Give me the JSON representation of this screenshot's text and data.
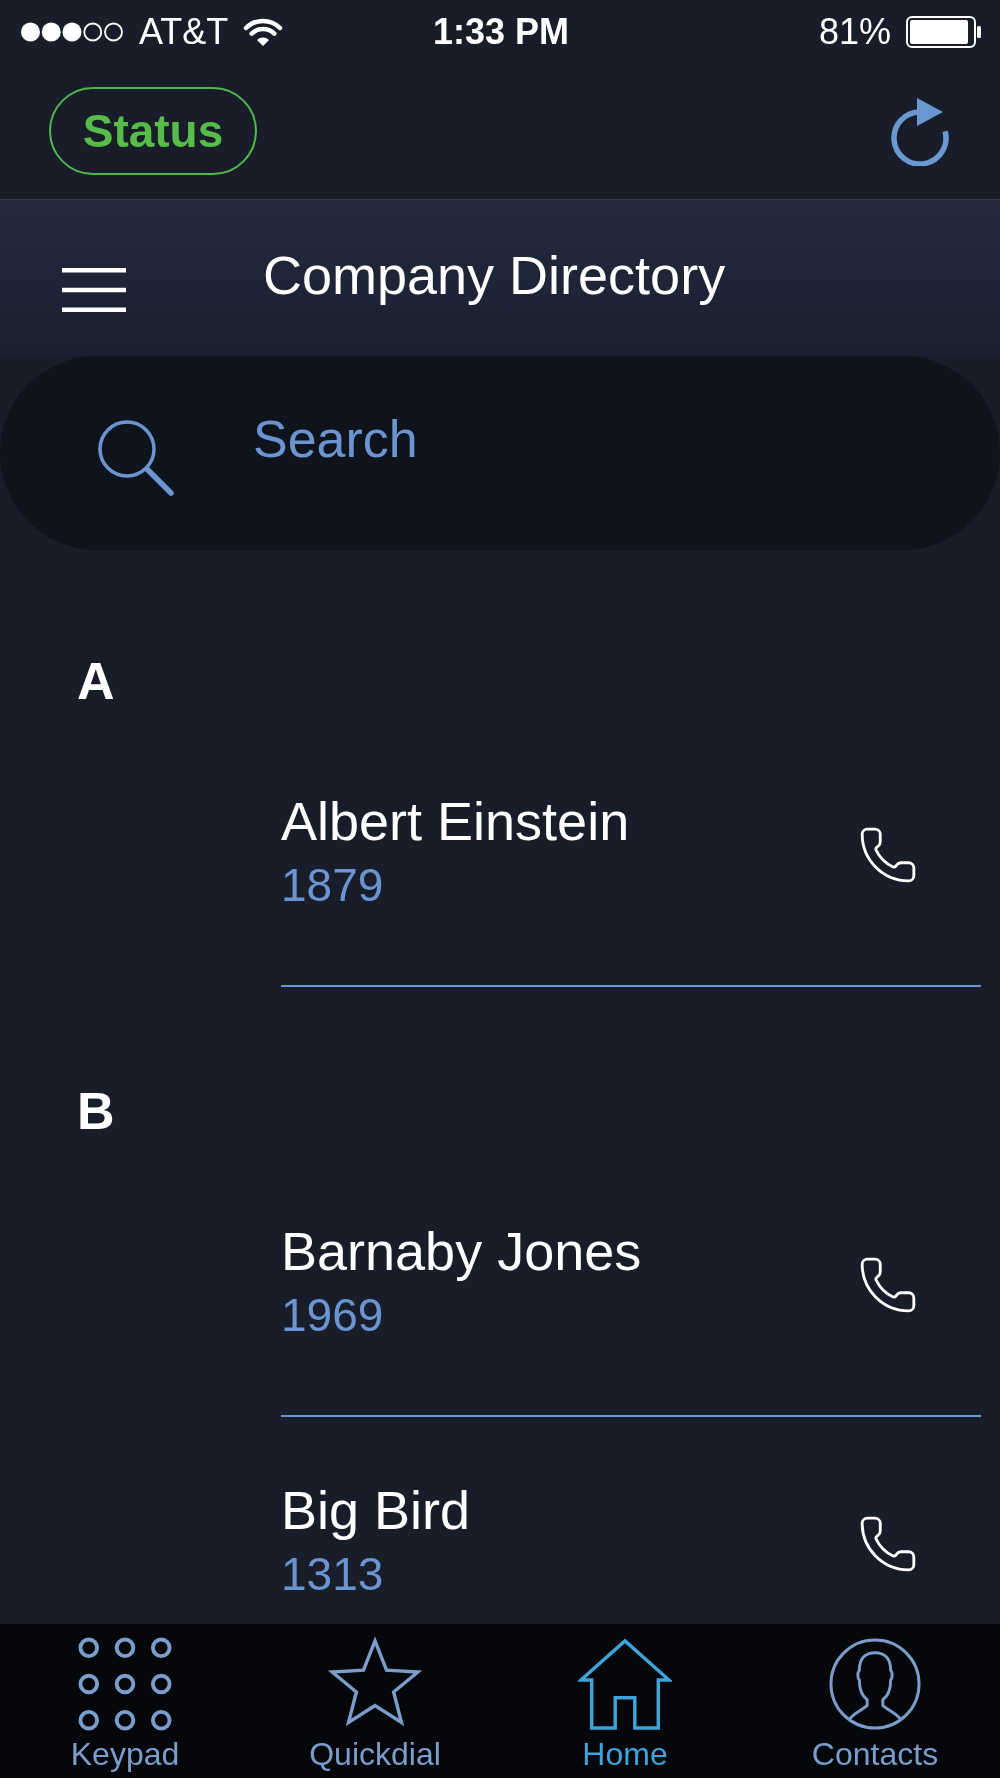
{
  "status_bar": {
    "carrier": "AT&T",
    "time": "1:33 PM",
    "battery": "81%"
  },
  "header": {
    "status_button": "Status"
  },
  "title_bar": {
    "title": "Company Directory"
  },
  "search": {
    "placeholder": "Search"
  },
  "sections": [
    {
      "letter": "A",
      "contacts": [
        {
          "name": "Albert Einstein",
          "extension": "1879"
        }
      ]
    },
    {
      "letter": "B",
      "contacts": [
        {
          "name": "Barnaby Jones",
          "extension": "1969"
        },
        {
          "name": "Big Bird",
          "extension": "1313"
        }
      ]
    }
  ],
  "tab_bar": [
    {
      "label": "Keypad",
      "kind": "keypad",
      "selected": false
    },
    {
      "label": "Quickdial",
      "kind": "star",
      "selected": false
    },
    {
      "label": "Home",
      "kind": "home",
      "selected": true
    },
    {
      "label": "Contacts",
      "kind": "contacts",
      "selected": false
    }
  ]
}
